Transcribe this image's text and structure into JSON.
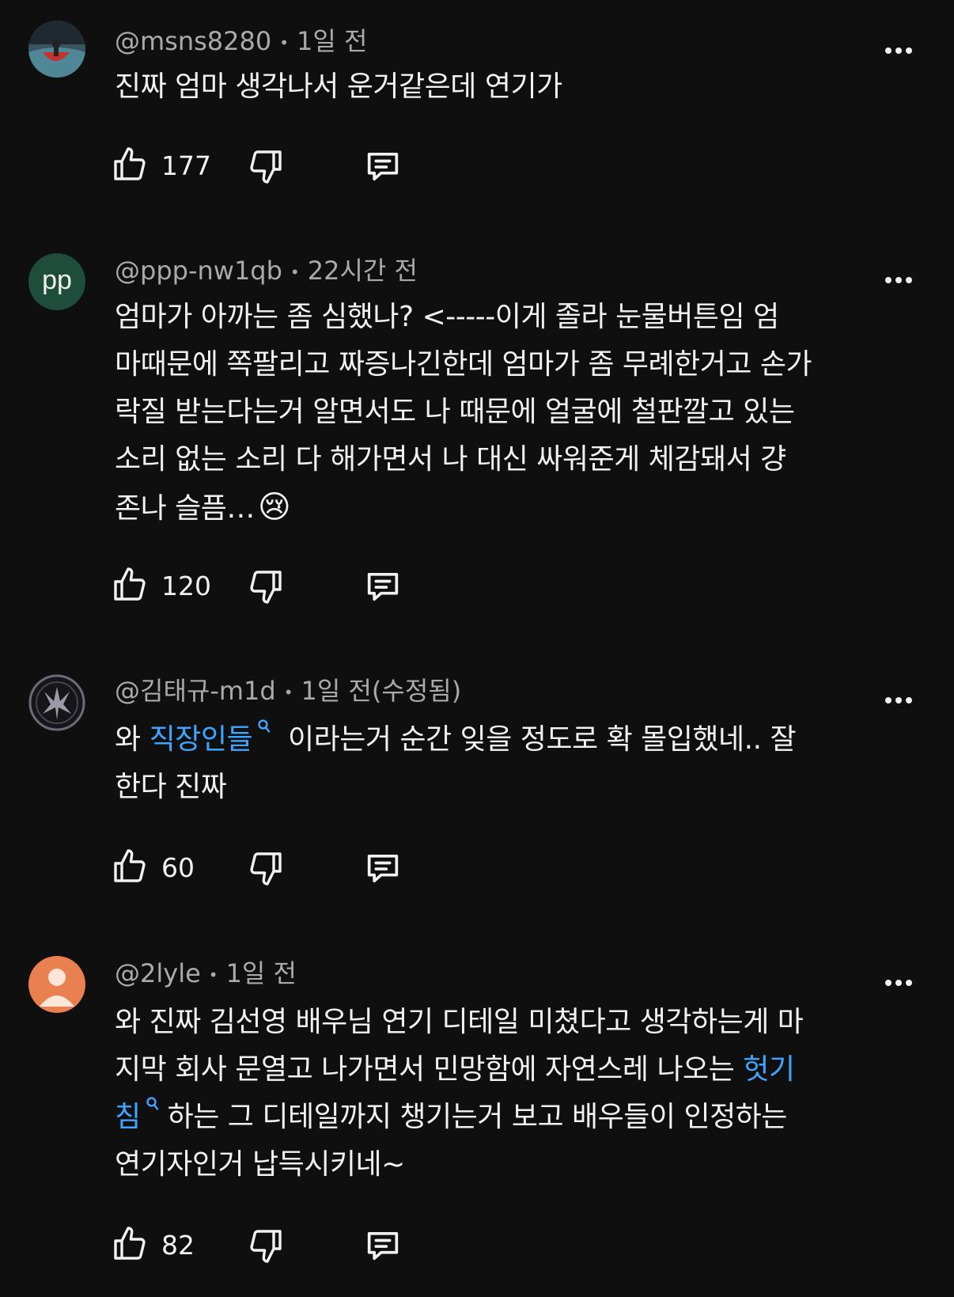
{
  "comments": [
    {
      "author": "@msns8280",
      "time": "1일 전",
      "text": "진짜 엄마 생각나서 운거같은데 연기가",
      "likes": "177",
      "avatar_kind": "image"
    },
    {
      "author": "@ppp-nw1qb",
      "time": "22시간 전",
      "text_lines": [
        "엄마가 아까는 좀 심했나? <-----이게 졸라 눈물버튼임 엄",
        "마때문에 쪽팔리고 짜증나긴한데 엄마가 좀 무례한거고 손가",
        "락질 받는다는거 알면서도 나 때문에 얼굴에 철판깔고 있는",
        "소리 없는 소리 다 해가면서 나 대신 싸워준게 체감돼서 걍",
        "존나 슬픔…"
      ],
      "emoji": "😢",
      "likes": "120",
      "avatar_initials": "pp",
      "avatar_color": "#1f4d3b"
    },
    {
      "author": "@김태규-m1d",
      "time": "1일 전(수정됨)",
      "text_before": "와 ",
      "link_text": "직장인들",
      "text_after_line1": " 이라는거 순간 잊을 정도로 확 몰입했네..  잘",
      "text_line2": "한다 진짜",
      "likes": "60",
      "avatar_kind": "image"
    },
    {
      "author": "@2lyle",
      "time": "1일 전",
      "line1": "와 진짜 김선영 배우님 연기 디테일 미쳤다고 생각하는게 마",
      "line2_before": "지막 회사 문열고 나가면서 민망함에 자연스레 나오는 ",
      "link_part1": "헛기",
      "link_part2": "침",
      "line3_after": "하는 그 디테일까지 챙기는거 보고 배우들이 인정하는",
      "line4": "연기자인거 납득시키네~",
      "likes": "82",
      "avatar_color": "#e8804f"
    }
  ],
  "colors": {
    "background": "#0f0f0f",
    "text": "#f1f1f1",
    "meta": "#aaaaaa",
    "link": "#3ea6ff"
  },
  "icons": [
    "thumbs-up-icon",
    "thumbs-down-icon",
    "reply-icon",
    "more-options-icon",
    "search-icon"
  ]
}
